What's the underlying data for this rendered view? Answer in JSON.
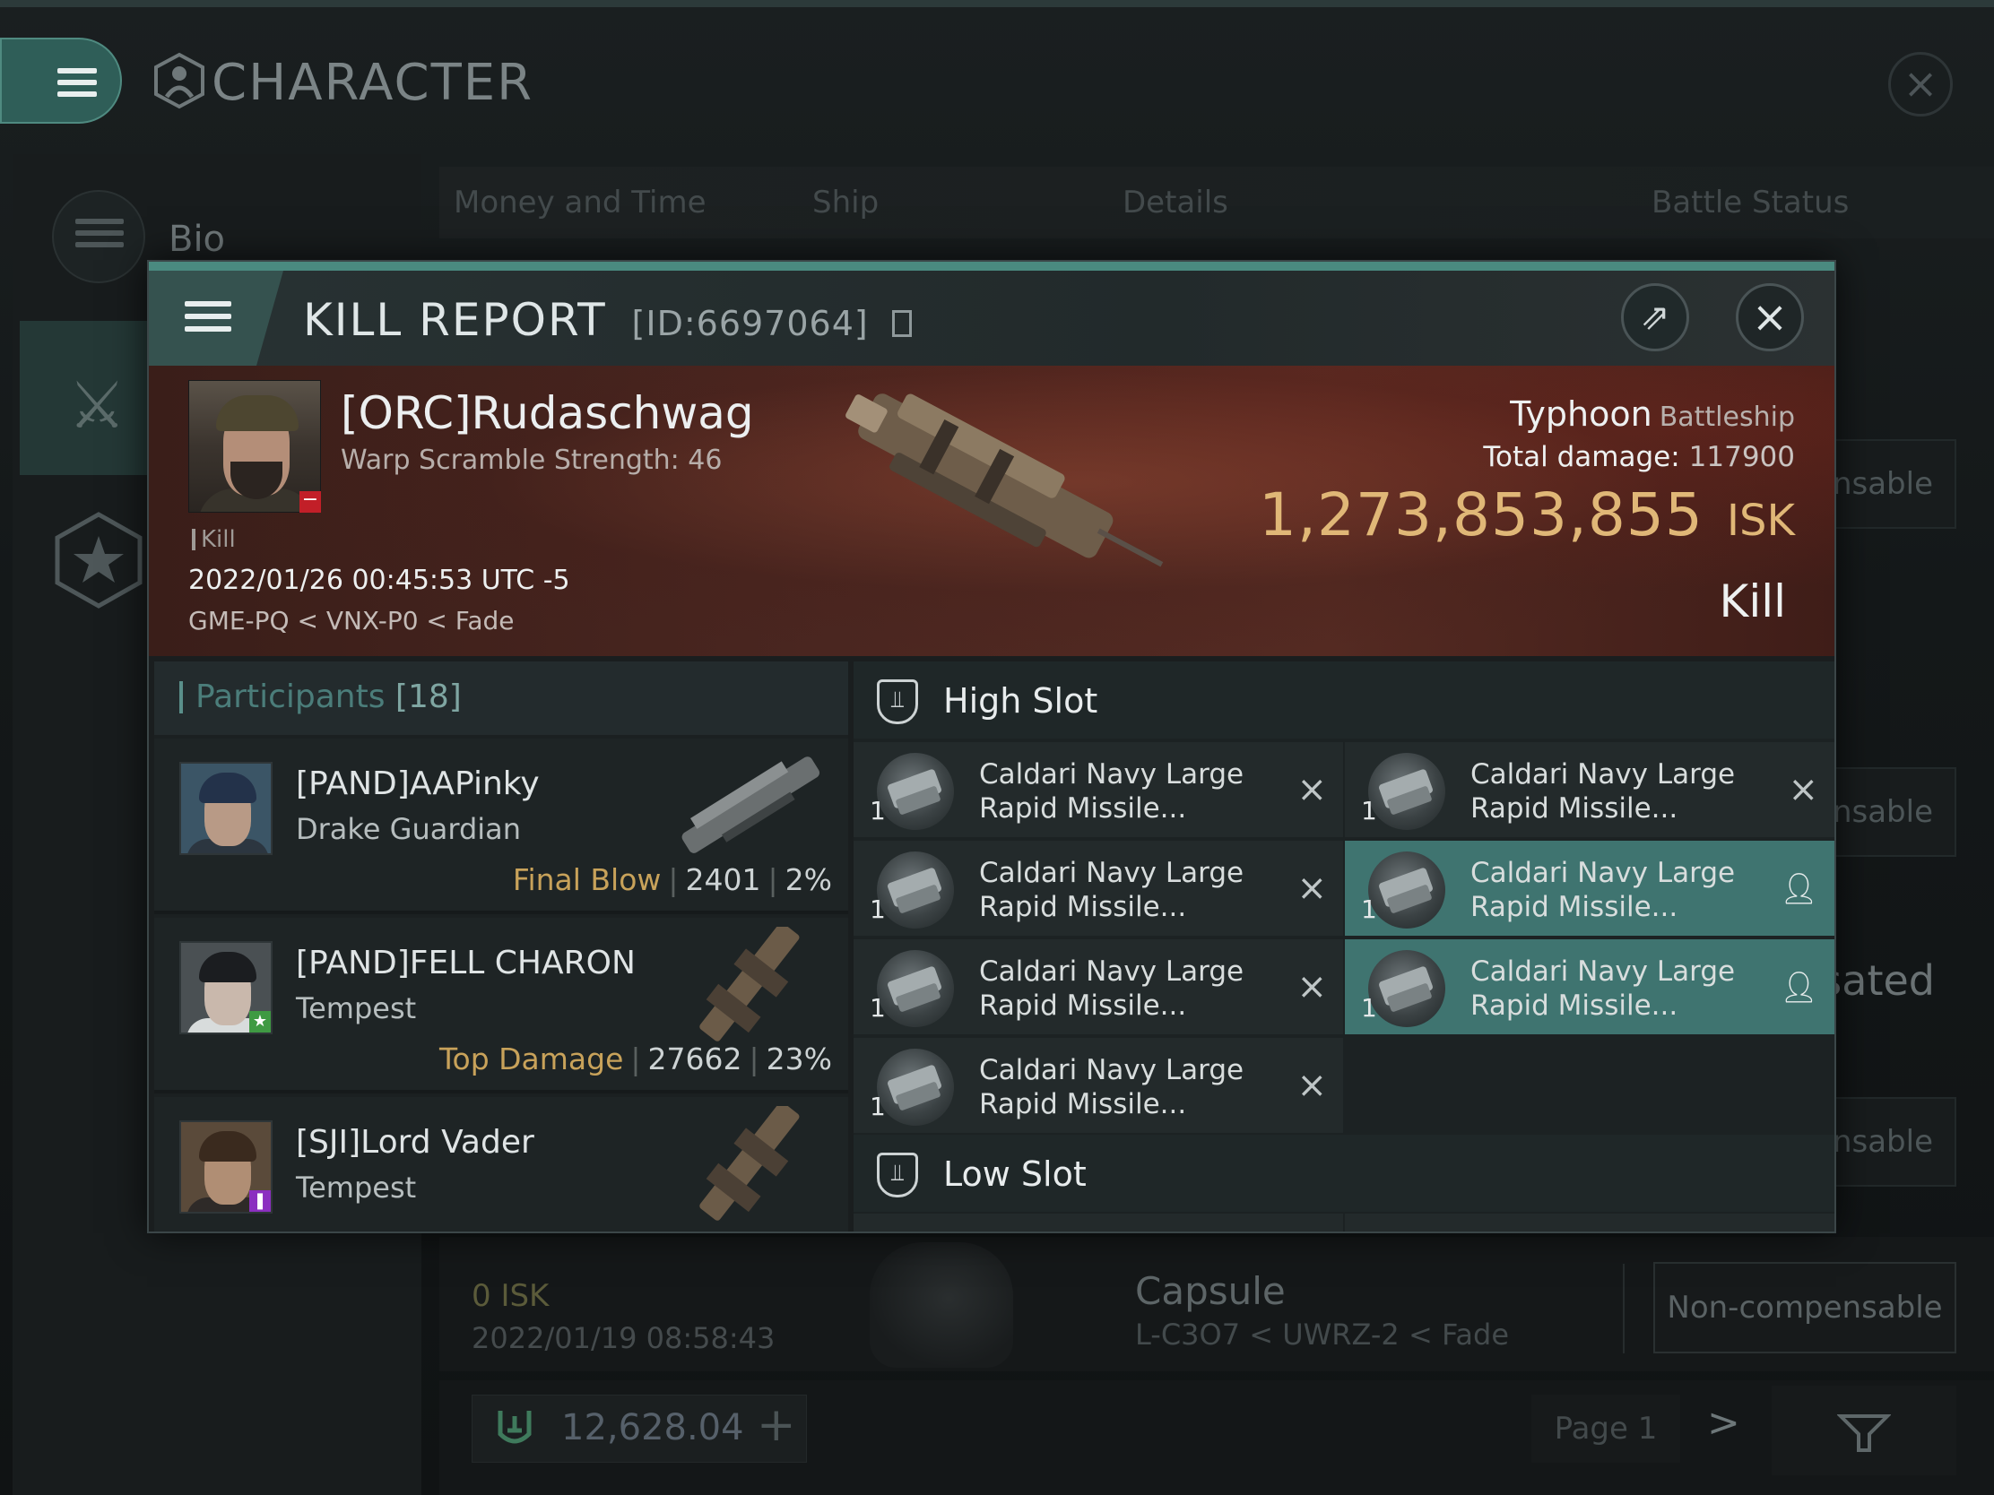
{
  "background": {
    "title": "CHARACTER",
    "sidebar": {
      "bio_label": "Bio"
    },
    "tabs": [
      "Money and Time",
      "Ship",
      "Details",
      "Battle Status"
    ],
    "row_buttons": [
      "ensable",
      "ensable",
      "sated",
      "ensable"
    ],
    "capsule_row": {
      "isk": "0  ISK",
      "date": "2022/01/19  08:58:43",
      "ship": "Capsule",
      "location": "L-C3O7 < UWRZ-2 < Fade",
      "button": "Non-compensable"
    },
    "wallet": "12,628.04",
    "page_label": "Page 1"
  },
  "kill_report": {
    "title": "KILL REPORT",
    "id": "[ID:6697064]",
    "victim": {
      "name": "[ORC]Rudaschwag",
      "scram": "Warp Scramble Strength: 46",
      "tag": "Kill",
      "datetime": "2022/01/26 00:45:53 UTC -5",
      "location": "GME-PQ < VNX-P0 < Fade"
    },
    "ship": {
      "name": "Typhoon",
      "class": "Battleship"
    },
    "total_damage_label": "Total damage:",
    "total_damage": "117900",
    "isk_value": "1,273,853,855",
    "isk_unit": "ISK",
    "result": "Kill",
    "participants": {
      "label": "Participants",
      "count": "[18]",
      "rows": [
        {
          "name": "[PAND]AAPinky",
          "ship": "Drake Guardian",
          "tag": "Final Blow",
          "damage": "2401",
          "pct": "2%"
        },
        {
          "name": "[PAND]FELL CHARON",
          "ship": "Tempest",
          "tag": "Top Damage",
          "damage": "27662",
          "pct": "23%"
        },
        {
          "name": "[SJI]Lord Vader",
          "ship": "Tempest"
        }
      ]
    },
    "high_slot": {
      "label": "High Slot",
      "items": [
        {
          "line1": "Caldari Navy Large",
          "line2": "Rapid Missile...",
          "qty": "1",
          "status": "destroyed"
        },
        {
          "line1": "Caldari Navy Large",
          "line2": "Rapid Missile...",
          "qty": "1",
          "status": "destroyed"
        },
        {
          "line1": "Caldari Navy Large",
          "line2": "Rapid Missile...",
          "qty": "1",
          "status": "destroyed"
        },
        {
          "line1": "Caldari Navy Large",
          "line2": "Rapid Missile...",
          "qty": "1",
          "status": "dropped"
        },
        {
          "line1": "Caldari Navy Large",
          "line2": "Rapid Missile...",
          "qty": "1",
          "status": "destroyed"
        },
        {
          "line1": "Caldari Navy Large",
          "line2": "Rapid Missile...",
          "qty": "1",
          "status": "dropped"
        },
        {
          "line1": "Caldari Navy Large",
          "line2": "Rapid Missile...",
          "qty": "1",
          "status": "destroyed"
        }
      ]
    },
    "low_slot": {
      "label": "Low Slot"
    }
  }
}
